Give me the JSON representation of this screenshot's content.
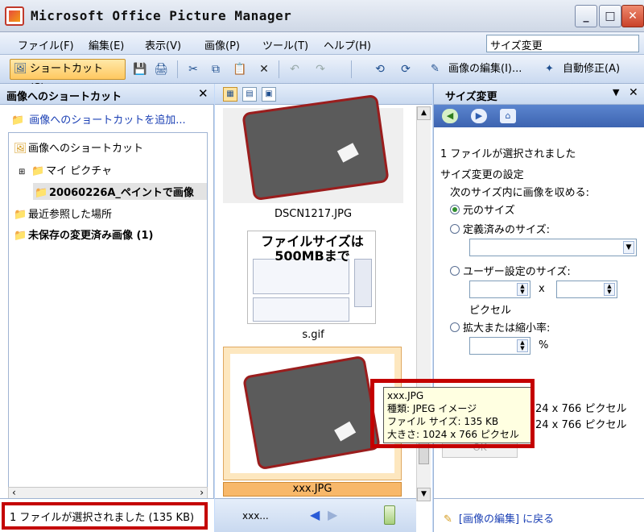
{
  "window": {
    "title": "Microsoft Office Picture Manager"
  },
  "menu": {
    "items": [
      "ファイル(F)",
      "編集(E)",
      "表示(V)",
      "画像(P)",
      "ツール(T)",
      "ヘルプ(H)"
    ],
    "help_box_value": "サイズ変更"
  },
  "toolbar": {
    "shortcut_label": "ショートカット(S)...",
    "edit_label": "画像の編集(I)...",
    "autofix_label": "自動修正(A)"
  },
  "left_pane": {
    "title": "画像へのショートカット",
    "add_shortcut": "画像へのショートカットを追加...",
    "tree": {
      "root": "画像へのショートカット",
      "my_pictures": "マイ ピクチャ",
      "selected_folder": "20060226A_ペイントで画像",
      "recent": "最近参照した場所",
      "unsaved": "未保存の変更済み画像 (1)"
    },
    "status": "1 ファイルが選択されました (135 KB)"
  },
  "middle_pane": {
    "thumbnails": [
      {
        "label": "DSCN1217.JPG"
      },
      {
        "label": "s.gif",
        "caption_line1": "ファイルサイズは",
        "caption_line2": "500MBまで"
      },
      {
        "label": "xxx.JPG"
      }
    ],
    "nav_file": "xxx..."
  },
  "tooltip": {
    "line1": "xxx.JPG",
    "line2": "種類: JPEG イメージ",
    "line3": "ファイル サイズ: 135 KB",
    "line4": "大きさ: 1024 x 766 ピクセル"
  },
  "right_pane": {
    "title": "サイズ変更",
    "selected_info": "1 ファイルが選択されました",
    "section_title": "サイズ変更の設定",
    "fit_label": "次のサイズ内に画像を収める:",
    "opt_original": "元のサイズ",
    "opt_predefined": "定義済みのサイズ:",
    "opt_custom": "ユーザー設定のサイズ:",
    "times": "x",
    "pixels": "ピクセル",
    "opt_percent": "拡大または縮小率:",
    "percent_sign": "%",
    "result_row1": "24 x 766 ピクセル",
    "result_row2": "24 x 766 ピクセル",
    "ok_button": "OK",
    "back_link": "[画像の編集] に戻る"
  },
  "colors": {
    "highlight_box": "#c40000",
    "selection": "#f8b86a"
  }
}
